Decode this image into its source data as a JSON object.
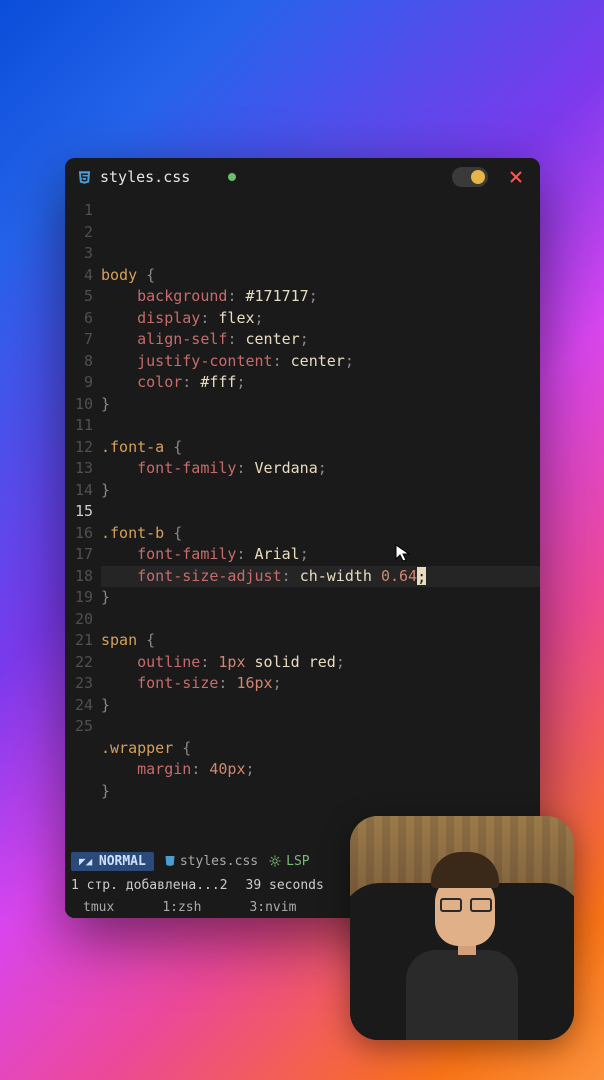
{
  "titlebar": {
    "filename": "styles.css",
    "modified": true
  },
  "editor": {
    "current_line": 15,
    "lines": [
      {
        "n": 1,
        "tokens": [
          [
            "sel",
            "body"
          ],
          [
            "punct",
            " {"
          ]
        ]
      },
      {
        "n": 2,
        "tokens": [
          [
            "pad",
            "    "
          ],
          [
            "prop",
            "background"
          ],
          [
            "punct",
            ": "
          ],
          [
            "hex",
            "#171717"
          ],
          [
            "punct",
            ";"
          ]
        ]
      },
      {
        "n": 3,
        "tokens": [
          [
            "pad",
            "    "
          ],
          [
            "prop",
            "display"
          ],
          [
            "punct",
            ": "
          ],
          [
            "val",
            "flex"
          ],
          [
            "punct",
            ";"
          ]
        ]
      },
      {
        "n": 4,
        "tokens": [
          [
            "pad",
            "    "
          ],
          [
            "prop",
            "align-self"
          ],
          [
            "punct",
            ": "
          ],
          [
            "val",
            "center"
          ],
          [
            "punct",
            ";"
          ]
        ]
      },
      {
        "n": 5,
        "tokens": [
          [
            "pad",
            "    "
          ],
          [
            "prop",
            "justify-content"
          ],
          [
            "punct",
            ": "
          ],
          [
            "val",
            "center"
          ],
          [
            "punct",
            ";"
          ]
        ]
      },
      {
        "n": 6,
        "tokens": [
          [
            "pad",
            "    "
          ],
          [
            "prop",
            "color"
          ],
          [
            "punct",
            ": "
          ],
          [
            "hex",
            "#fff"
          ],
          [
            "punct",
            ";"
          ]
        ]
      },
      {
        "n": 7,
        "tokens": [
          [
            "punct",
            "}"
          ]
        ]
      },
      {
        "n": 8,
        "tokens": []
      },
      {
        "n": 9,
        "tokens": [
          [
            "sel",
            ".font-a"
          ],
          [
            "punct",
            " {"
          ]
        ]
      },
      {
        "n": 10,
        "tokens": [
          [
            "pad",
            "    "
          ],
          [
            "prop",
            "font-family"
          ],
          [
            "punct",
            ": "
          ],
          [
            "val",
            "Verdana"
          ],
          [
            "punct",
            ";"
          ]
        ]
      },
      {
        "n": 11,
        "tokens": [
          [
            "punct",
            "}"
          ]
        ]
      },
      {
        "n": 12,
        "tokens": []
      },
      {
        "n": 13,
        "tokens": [
          [
            "sel",
            ".font-b"
          ],
          [
            "punct",
            " {"
          ]
        ]
      },
      {
        "n": 14,
        "tokens": [
          [
            "pad",
            "    "
          ],
          [
            "prop",
            "font-family"
          ],
          [
            "punct",
            ": "
          ],
          [
            "val",
            "Arial"
          ],
          [
            "punct",
            ";"
          ]
        ]
      },
      {
        "n": 15,
        "tokens": [
          [
            "pad",
            "    "
          ],
          [
            "prop",
            "font-size-adjust"
          ],
          [
            "punct",
            ": "
          ],
          [
            "val",
            "ch-width "
          ],
          [
            "num",
            "0.64"
          ],
          [
            "cursor",
            ";"
          ]
        ]
      },
      {
        "n": 16,
        "tokens": [
          [
            "punct",
            "}"
          ]
        ]
      },
      {
        "n": 17,
        "tokens": []
      },
      {
        "n": 18,
        "tokens": [
          [
            "sel",
            "span"
          ],
          [
            "punct",
            " {"
          ]
        ]
      },
      {
        "n": 19,
        "tokens": [
          [
            "pad",
            "    "
          ],
          [
            "prop",
            "outline"
          ],
          [
            "punct",
            ": "
          ],
          [
            "num",
            "1px"
          ],
          [
            "val",
            " solid red"
          ],
          [
            "punct",
            ";"
          ]
        ]
      },
      {
        "n": 20,
        "tokens": [
          [
            "pad",
            "    "
          ],
          [
            "prop",
            "font-size"
          ],
          [
            "punct",
            ": "
          ],
          [
            "num",
            "16px"
          ],
          [
            "punct",
            ";"
          ]
        ]
      },
      {
        "n": 21,
        "tokens": [
          [
            "punct",
            "}"
          ]
        ]
      },
      {
        "n": 22,
        "tokens": []
      },
      {
        "n": 23,
        "tokens": [
          [
            "sel",
            ".wrapper"
          ],
          [
            "punct",
            " {"
          ]
        ]
      },
      {
        "n": 24,
        "tokens": [
          [
            "pad",
            "    "
          ],
          [
            "prop",
            "margin"
          ],
          [
            "punct",
            ": "
          ],
          [
            "num",
            "40px"
          ],
          [
            "punct",
            ";"
          ]
        ]
      },
      {
        "n": 25,
        "tokens": [
          [
            "punct",
            "}"
          ]
        ]
      }
    ]
  },
  "statusbar": {
    "mode": "NORMAL",
    "file": "styles.css",
    "lsp": "LSP"
  },
  "messagebar": {
    "msg1": "1 стр. добавлена...2",
    "msg2": "39 seconds"
  },
  "tmux": {
    "session": "tmux",
    "win1": "1:zsh",
    "win2": "3:nvim"
  }
}
